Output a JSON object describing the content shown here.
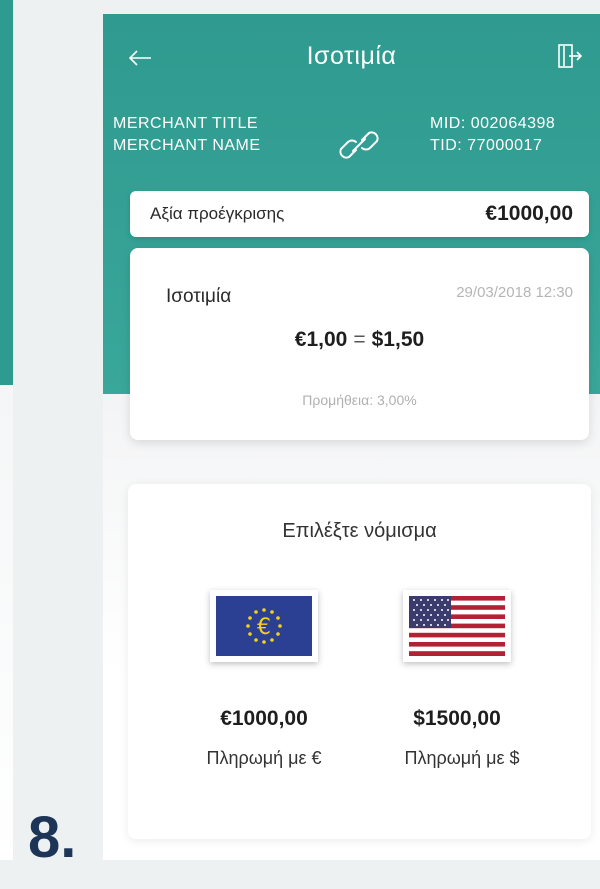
{
  "header": {
    "title": "Ισοτιμία",
    "back_icon": "arrow-left-icon",
    "logout_icon": "logout-door-icon"
  },
  "merchant": {
    "title": "MERCHANT TITLE",
    "name": "MERCHANT NAME",
    "link_icon": "link-icon",
    "mid": "MID: 002064398",
    "tid": "TID: 77000017"
  },
  "preauth": {
    "label": "Αξία προέγκρισης",
    "value": "€1000,00"
  },
  "rate": {
    "title": "Ισοτιμία",
    "datetime": "29/03/2018 12:30",
    "from": "€1,00",
    "equals": "=",
    "to": "$1,50",
    "fee": "Προμήθεια: 3,00%"
  },
  "currency_select": {
    "title": "Επιλέξτε νόμισμα",
    "options": [
      {
        "flag_icon": "eu-flag-icon",
        "amount": "€1000,00",
        "label": "Πληρωμή με €"
      },
      {
        "flag_icon": "us-flag-icon",
        "amount": "$1500,00",
        "label": "Πληρωμή με $"
      }
    ]
  },
  "step": {
    "number": "8."
  },
  "colors": {
    "header": "#2f9a8f",
    "text_dark": "#1e1e1e",
    "step_number": "#1d3557"
  }
}
